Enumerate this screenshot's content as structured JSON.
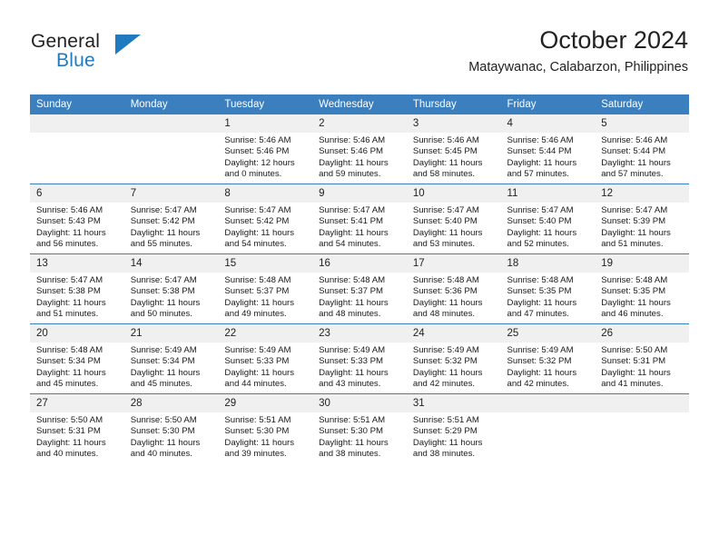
{
  "brand": {
    "name_part1": "General",
    "name_part2": "Blue",
    "logo_icon": "triangle-flag-icon",
    "accent_color": "#1f7ac0"
  },
  "header": {
    "title": "October 2024",
    "subtitle": "Mataywanac, Calabarzon, Philippines"
  },
  "calendar": {
    "header_bg": "#3b7fbe",
    "daynum_bg": "#f0f0f0",
    "weekdays": [
      "Sunday",
      "Monday",
      "Tuesday",
      "Wednesday",
      "Thursday",
      "Friday",
      "Saturday"
    ],
    "weeks": [
      [
        {
          "day": "",
          "sunrise": "",
          "sunset": "",
          "daylight1": "",
          "daylight2": ""
        },
        {
          "day": "",
          "sunrise": "",
          "sunset": "",
          "daylight1": "",
          "daylight2": ""
        },
        {
          "day": "1",
          "sunrise": "Sunrise: 5:46 AM",
          "sunset": "Sunset: 5:46 PM",
          "daylight1": "Daylight: 12 hours",
          "daylight2": "and 0 minutes."
        },
        {
          "day": "2",
          "sunrise": "Sunrise: 5:46 AM",
          "sunset": "Sunset: 5:46 PM",
          "daylight1": "Daylight: 11 hours",
          "daylight2": "and 59 minutes."
        },
        {
          "day": "3",
          "sunrise": "Sunrise: 5:46 AM",
          "sunset": "Sunset: 5:45 PM",
          "daylight1": "Daylight: 11 hours",
          "daylight2": "and 58 minutes."
        },
        {
          "day": "4",
          "sunrise": "Sunrise: 5:46 AM",
          "sunset": "Sunset: 5:44 PM",
          "daylight1": "Daylight: 11 hours",
          "daylight2": "and 57 minutes."
        },
        {
          "day": "5",
          "sunrise": "Sunrise: 5:46 AM",
          "sunset": "Sunset: 5:44 PM",
          "daylight1": "Daylight: 11 hours",
          "daylight2": "and 57 minutes."
        }
      ],
      [
        {
          "day": "6",
          "sunrise": "Sunrise: 5:46 AM",
          "sunset": "Sunset: 5:43 PM",
          "daylight1": "Daylight: 11 hours",
          "daylight2": "and 56 minutes."
        },
        {
          "day": "7",
          "sunrise": "Sunrise: 5:47 AM",
          "sunset": "Sunset: 5:42 PM",
          "daylight1": "Daylight: 11 hours",
          "daylight2": "and 55 minutes."
        },
        {
          "day": "8",
          "sunrise": "Sunrise: 5:47 AM",
          "sunset": "Sunset: 5:42 PM",
          "daylight1": "Daylight: 11 hours",
          "daylight2": "and 54 minutes."
        },
        {
          "day": "9",
          "sunrise": "Sunrise: 5:47 AM",
          "sunset": "Sunset: 5:41 PM",
          "daylight1": "Daylight: 11 hours",
          "daylight2": "and 54 minutes."
        },
        {
          "day": "10",
          "sunrise": "Sunrise: 5:47 AM",
          "sunset": "Sunset: 5:40 PM",
          "daylight1": "Daylight: 11 hours",
          "daylight2": "and 53 minutes."
        },
        {
          "day": "11",
          "sunrise": "Sunrise: 5:47 AM",
          "sunset": "Sunset: 5:40 PM",
          "daylight1": "Daylight: 11 hours",
          "daylight2": "and 52 minutes."
        },
        {
          "day": "12",
          "sunrise": "Sunrise: 5:47 AM",
          "sunset": "Sunset: 5:39 PM",
          "daylight1": "Daylight: 11 hours",
          "daylight2": "and 51 minutes."
        }
      ],
      [
        {
          "day": "13",
          "sunrise": "Sunrise: 5:47 AM",
          "sunset": "Sunset: 5:38 PM",
          "daylight1": "Daylight: 11 hours",
          "daylight2": "and 51 minutes."
        },
        {
          "day": "14",
          "sunrise": "Sunrise: 5:47 AM",
          "sunset": "Sunset: 5:38 PM",
          "daylight1": "Daylight: 11 hours",
          "daylight2": "and 50 minutes."
        },
        {
          "day": "15",
          "sunrise": "Sunrise: 5:48 AM",
          "sunset": "Sunset: 5:37 PM",
          "daylight1": "Daylight: 11 hours",
          "daylight2": "and 49 minutes."
        },
        {
          "day": "16",
          "sunrise": "Sunrise: 5:48 AM",
          "sunset": "Sunset: 5:37 PM",
          "daylight1": "Daylight: 11 hours",
          "daylight2": "and 48 minutes."
        },
        {
          "day": "17",
          "sunrise": "Sunrise: 5:48 AM",
          "sunset": "Sunset: 5:36 PM",
          "daylight1": "Daylight: 11 hours",
          "daylight2": "and 48 minutes."
        },
        {
          "day": "18",
          "sunrise": "Sunrise: 5:48 AM",
          "sunset": "Sunset: 5:35 PM",
          "daylight1": "Daylight: 11 hours",
          "daylight2": "and 47 minutes."
        },
        {
          "day": "19",
          "sunrise": "Sunrise: 5:48 AM",
          "sunset": "Sunset: 5:35 PM",
          "daylight1": "Daylight: 11 hours",
          "daylight2": "and 46 minutes."
        }
      ],
      [
        {
          "day": "20",
          "sunrise": "Sunrise: 5:48 AM",
          "sunset": "Sunset: 5:34 PM",
          "daylight1": "Daylight: 11 hours",
          "daylight2": "and 45 minutes."
        },
        {
          "day": "21",
          "sunrise": "Sunrise: 5:49 AM",
          "sunset": "Sunset: 5:34 PM",
          "daylight1": "Daylight: 11 hours",
          "daylight2": "and 45 minutes."
        },
        {
          "day": "22",
          "sunrise": "Sunrise: 5:49 AM",
          "sunset": "Sunset: 5:33 PM",
          "daylight1": "Daylight: 11 hours",
          "daylight2": "and 44 minutes."
        },
        {
          "day": "23",
          "sunrise": "Sunrise: 5:49 AM",
          "sunset": "Sunset: 5:33 PM",
          "daylight1": "Daylight: 11 hours",
          "daylight2": "and 43 minutes."
        },
        {
          "day": "24",
          "sunrise": "Sunrise: 5:49 AM",
          "sunset": "Sunset: 5:32 PM",
          "daylight1": "Daylight: 11 hours",
          "daylight2": "and 42 minutes."
        },
        {
          "day": "25",
          "sunrise": "Sunrise: 5:49 AM",
          "sunset": "Sunset: 5:32 PM",
          "daylight1": "Daylight: 11 hours",
          "daylight2": "and 42 minutes."
        },
        {
          "day": "26",
          "sunrise": "Sunrise: 5:50 AM",
          "sunset": "Sunset: 5:31 PM",
          "daylight1": "Daylight: 11 hours",
          "daylight2": "and 41 minutes."
        }
      ],
      [
        {
          "day": "27",
          "sunrise": "Sunrise: 5:50 AM",
          "sunset": "Sunset: 5:31 PM",
          "daylight1": "Daylight: 11 hours",
          "daylight2": "and 40 minutes."
        },
        {
          "day": "28",
          "sunrise": "Sunrise: 5:50 AM",
          "sunset": "Sunset: 5:30 PM",
          "daylight1": "Daylight: 11 hours",
          "daylight2": "and 40 minutes."
        },
        {
          "day": "29",
          "sunrise": "Sunrise: 5:51 AM",
          "sunset": "Sunset: 5:30 PM",
          "daylight1": "Daylight: 11 hours",
          "daylight2": "and 39 minutes."
        },
        {
          "day": "30",
          "sunrise": "Sunrise: 5:51 AM",
          "sunset": "Sunset: 5:30 PM",
          "daylight1": "Daylight: 11 hours",
          "daylight2": "and 38 minutes."
        },
        {
          "day": "31",
          "sunrise": "Sunrise: 5:51 AM",
          "sunset": "Sunset: 5:29 PM",
          "daylight1": "Daylight: 11 hours",
          "daylight2": "and 38 minutes."
        },
        {
          "day": "",
          "sunrise": "",
          "sunset": "",
          "daylight1": "",
          "daylight2": ""
        },
        {
          "day": "",
          "sunrise": "",
          "sunset": "",
          "daylight1": "",
          "daylight2": ""
        }
      ]
    ]
  }
}
